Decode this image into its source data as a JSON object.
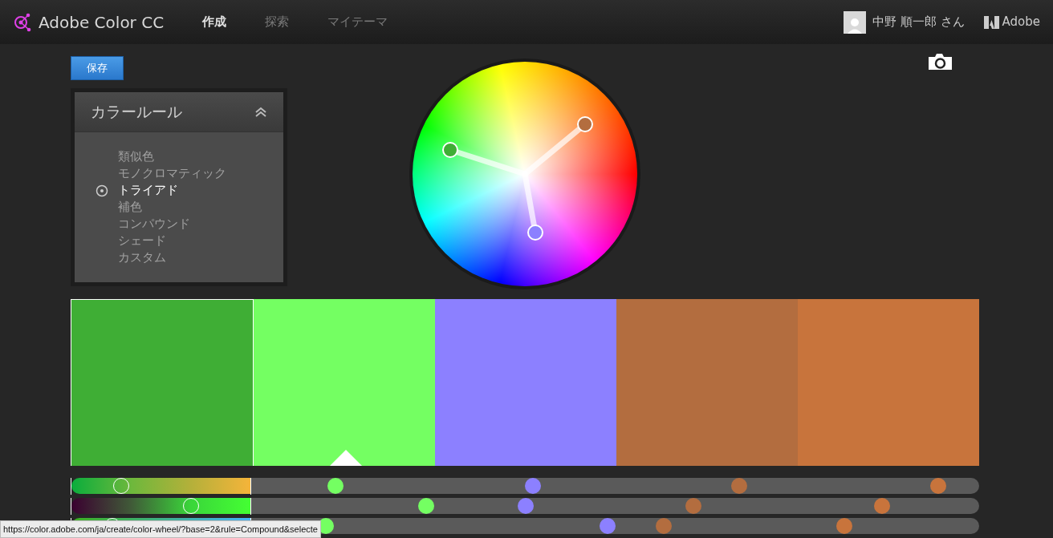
{
  "header": {
    "app_title": "Adobe Color CC",
    "nav": [
      {
        "label": "作成",
        "selected": true
      },
      {
        "label": "探索",
        "selected": false
      },
      {
        "label": "マイテーマ",
        "selected": false
      }
    ],
    "user_name": "中野 順一郎 さん",
    "brand": "Adobe"
  },
  "save_button": "保存",
  "color_rule_panel": {
    "title": "カラールール",
    "items": [
      {
        "label": "類似色",
        "selected": false
      },
      {
        "label": "モノクロマティック",
        "selected": false
      },
      {
        "label": "トライアド",
        "selected": true
      },
      {
        "label": "補色",
        "selected": false
      },
      {
        "label": "コンパウンド",
        "selected": false
      },
      {
        "label": "シェード",
        "selected": false
      },
      {
        "label": "カスタム",
        "selected": false
      }
    ]
  },
  "swatches": [
    {
      "color": "#3fae35",
      "selected": true
    },
    {
      "color": "#74ff62",
      "selected": false
    },
    {
      "color": "#8c80ff",
      "selected": false
    },
    {
      "color": "#b36d3f",
      "selected": false
    },
    {
      "color": "#c8743c",
      "selected": false
    }
  ],
  "slider_rows": [
    {
      "level": 0.28,
      "markers": [
        {
          "color": "#74ff62",
          "level": 0.116
        },
        {
          "color": "#8c80ff",
          "level": 0.387
        },
        {
          "color": "#b36d3f",
          "level": 0.67
        },
        {
          "color": "#c8743c",
          "level": 0.944
        }
      ]
    },
    {
      "level": 0.67,
      "markers": [
        {
          "color": "#74ff62",
          "level": 0.24
        },
        {
          "color": "#8c80ff",
          "level": 0.377
        },
        {
          "color": "#b36d3f",
          "level": 0.607
        },
        {
          "color": "#c8743c",
          "level": 0.867
        }
      ]
    },
    {
      "level": 0.23,
      "markers": [
        {
          "color": "#74ff62",
          "level": 0.103
        },
        {
          "color": "#8c80ff",
          "level": 0.49
        },
        {
          "color": "#b36d3f",
          "level": 0.567
        },
        {
          "color": "#c8743c",
          "level": 0.815
        }
      ]
    }
  ],
  "status_bar": "https://color.adobe.com/ja/create/color-wheel/?base=2&rule=Compound&selecte"
}
